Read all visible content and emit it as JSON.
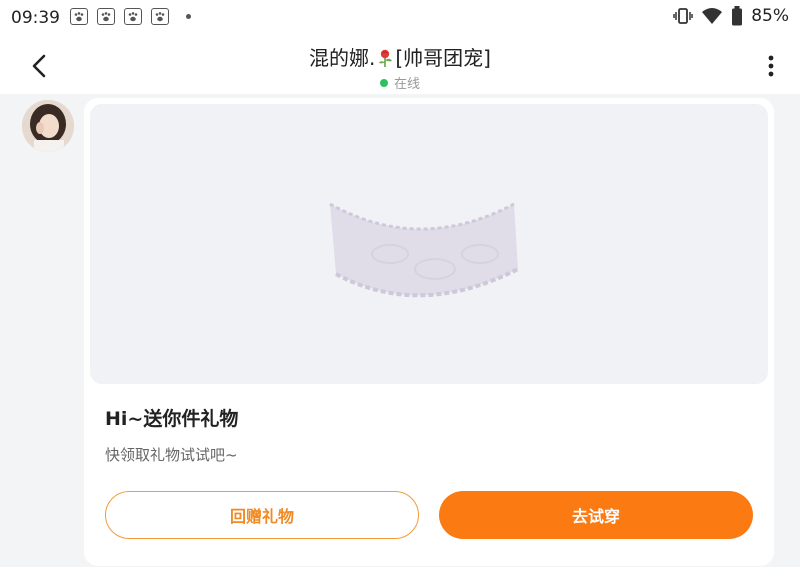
{
  "status_bar": {
    "time": "09:39",
    "battery": "85%"
  },
  "header": {
    "title_prefix": "混的娜.",
    "title_suffix": "[帅哥团宠]",
    "status": "在线",
    "online_color": "#2bc160"
  },
  "gift_card": {
    "title": "Hi~送你件礼物",
    "subtitle": "快领取礼物试试吧~",
    "return_button": "回赠礼物",
    "try_button": "去试穿",
    "accent_color": "#fb7a12"
  }
}
